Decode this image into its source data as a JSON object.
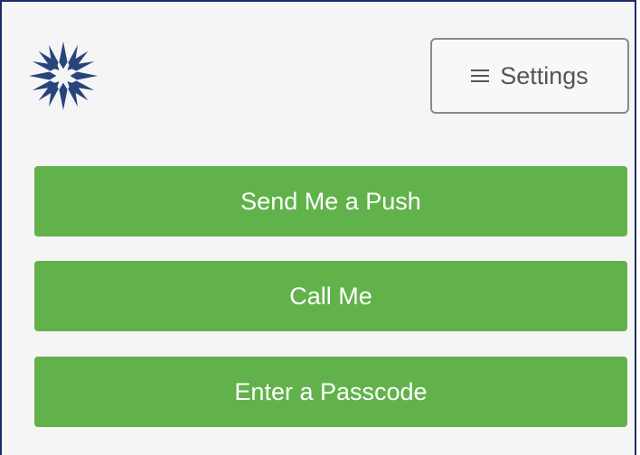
{
  "header": {
    "logo_icon": "starburst-logo",
    "settings_label": "Settings",
    "settings_icon": "hamburger-menu"
  },
  "actions": [
    {
      "label": "Send Me a Push"
    },
    {
      "label": "Call Me"
    },
    {
      "label": "Enter a Passcode"
    }
  ],
  "colors": {
    "frame_border": "#1f2b66",
    "background": "#f5f5f5",
    "logo": "#27457a",
    "primary_button": "#62b24b",
    "primary_text": "#ffffff",
    "settings_border": "#8a8a8a",
    "settings_text": "#555555"
  }
}
